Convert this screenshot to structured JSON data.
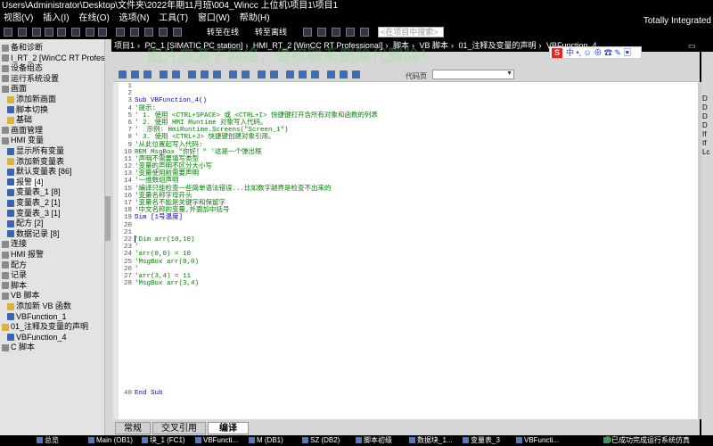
{
  "window": {
    "title": "Users\\Administrator\\Desktop\\文件夹\\2022年期11月班\\004_Wincc 上位机\\项目1\\项目1",
    "brand": "Totally Integrated"
  },
  "menu": [
    "视图(V)",
    "插入(I)",
    "在线(O)",
    "选项(N)",
    "工具(T)",
    "窗口(W)",
    "帮助(H)"
  ],
  "toolbar": {
    "go_online": "转至在线",
    "go_offline": "转至离线",
    "search_placeholder": "<在项目中搜索>"
  },
  "breadcrumb": [
    "项目1",
    "PC_1 [SIMATIC PC station]",
    "HMI_RT_2 [WinCC RT Professional]",
    "脚本",
    "VB 脚本",
    "01_注释及变量的声明",
    "VBFunction_4"
  ],
  "watermark": "图片来源于网络，侵权联系删除代删除！",
  "float_bar": "中 •, ☺ ⊕ ☎ ✎ ▣",
  "tree": [
    {
      "label": "备和诊断",
      "icon": "ic-gray"
    },
    {
      "label": "I_RT_2 [WinCC RT Professio...",
      "icon": "ic-gray"
    },
    {
      "label": "设备组态",
      "icon": "ic-gray"
    },
    {
      "label": "运行系统设置",
      "icon": "ic-gray"
    },
    {
      "label": "画面",
      "icon": "ic-gray"
    },
    {
      "label": "添加新画面",
      "icon": "ic-yellow"
    },
    {
      "label": "脚本切换",
      "icon": "ic-blue"
    },
    {
      "label": "基础",
      "icon": "ic-yellow"
    },
    {
      "label": "画面管理",
      "icon": "ic-gray"
    },
    {
      "label": "HMI 变量",
      "icon": "ic-gray"
    },
    {
      "label": "显示所有变量",
      "icon": "ic-blue"
    },
    {
      "label": "添加新变量表",
      "icon": "ic-yellow"
    },
    {
      "label": "默认变量表 [86]",
      "icon": "ic-blue"
    },
    {
      "label": "报警 [4]",
      "icon": "ic-blue"
    },
    {
      "label": "变量表_1 [8]",
      "icon": "ic-blue"
    },
    {
      "label": "变量表_2 [1]",
      "icon": "ic-blue"
    },
    {
      "label": "变量表_3 [1]",
      "icon": "ic-blue"
    },
    {
      "label": "配方 [2]",
      "icon": "ic-blue"
    },
    {
      "label": "数据记录 [8]",
      "icon": "ic-blue"
    },
    {
      "label": "连接",
      "icon": "ic-gray"
    },
    {
      "label": "HMI 报警",
      "icon": "ic-gray"
    },
    {
      "label": "配方",
      "icon": "ic-gray"
    },
    {
      "label": "记录",
      "icon": "ic-gray"
    },
    {
      "label": "脚本",
      "icon": "ic-gray"
    },
    {
      "label": "VB 脚本",
      "icon": "ic-gray"
    },
    {
      "label": "添加新 VB 函数",
      "icon": "ic-yellow"
    },
    {
      "label": "VBFunction_1",
      "icon": "ic-blue"
    },
    {
      "label": "01_注释及变量的声明",
      "icon": "ic-yellow"
    },
    {
      "label": "VBFunction_4",
      "icon": "ic-blue"
    },
    {
      "label": "C 脚本",
      "icon": "ic-gray"
    }
  ],
  "editor": {
    "codepage_label": "代码页",
    "codepage_value": "",
    "line_numbers": [
      "1",
      "2",
      "3",
      "4",
      "5",
      "6",
      "7",
      "8",
      "9",
      "10",
      "11",
      "12",
      "13",
      "14",
      "15",
      "16",
      "17",
      "18",
      "19",
      "20",
      "21",
      "22",
      "23",
      "24",
      "25",
      "26",
      "27",
      "28"
    ],
    "lines": [
      "",
      "",
      "Sub VBFunction_4()",
      "'提示:",
      "' 1. 使用 <CTRL+SPACE> 或 <CTRL+I> 快捷键打开含所有对象和函数的列表",
      "' 2. 使用 HMI Runtime 对象写入代码。",
      "'  示例: HmiRuntime.Screens(\"Screen_1\")",
      "' 3. 使用 <CTRL+J> 快捷键创建对象引用。",
      "'从此位置起写入代码:",
      "REM MsgBox \"你好！\" '这是一个弹出框",
      "'声明不需要填写类型",
      "'变量的声明不区分大小写",
      "'变量使用前需要声明",
      "'一维数组声明",
      "'编译只能检查一些简单语法错误...比如数字越界是检查不出来的",
      "'变量名称字母开头",
      "'变量名不能是关键字和保留字",
      "'中文名称的变量,外面加中括号",
      "Dim [1号温度]",
      "",
      "",
      "'Dim arr(10,10)",
      "'",
      "'arr(0,0) = 10",
      "'MsgBox arr(0,0)",
      "'",
      "'arr(3,4) = 11",
      "'MsgBox arr(3,4)"
    ],
    "end_line_number": "40",
    "end_line": "End Sub"
  },
  "tabs": [
    "常规",
    "交叉引用",
    "编译"
  ],
  "right_panel": [
    "D",
    "D",
    "D",
    "D",
    "If",
    "If",
    "Lc"
  ],
  "taskbar": {
    "items": [
      "总览",
      "Main (OB1)",
      "块_1 (FC1)",
      "VBFuncti...",
      "M (DB1)",
      "SZ (DB2)",
      "脚本初级",
      "数据块_1...",
      "变量表_3",
      "VBFuncti..."
    ],
    "status": "已成功完成运行系统仿真"
  }
}
